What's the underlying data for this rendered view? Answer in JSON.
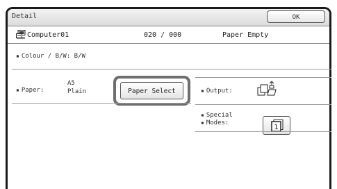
{
  "window": {
    "title": "Detail",
    "ok_label": "OK"
  },
  "job": {
    "icon": "computer-printer-icon",
    "name": "Computer01",
    "count": "020 / 000",
    "status": "Paper Empty"
  },
  "settings": {
    "colour": "Colour / B/W: B/W",
    "paper_label": "Paper:",
    "paper_size": "A5",
    "paper_type": "Plain",
    "paper_select_label": "Paper Select",
    "output_label": "Output:",
    "output_icon": "output-tray-icon",
    "special_modes_label_line1": "Special",
    "special_modes_label_line2": "Modes:",
    "special_modes_icon": "special-modes-icon"
  }
}
